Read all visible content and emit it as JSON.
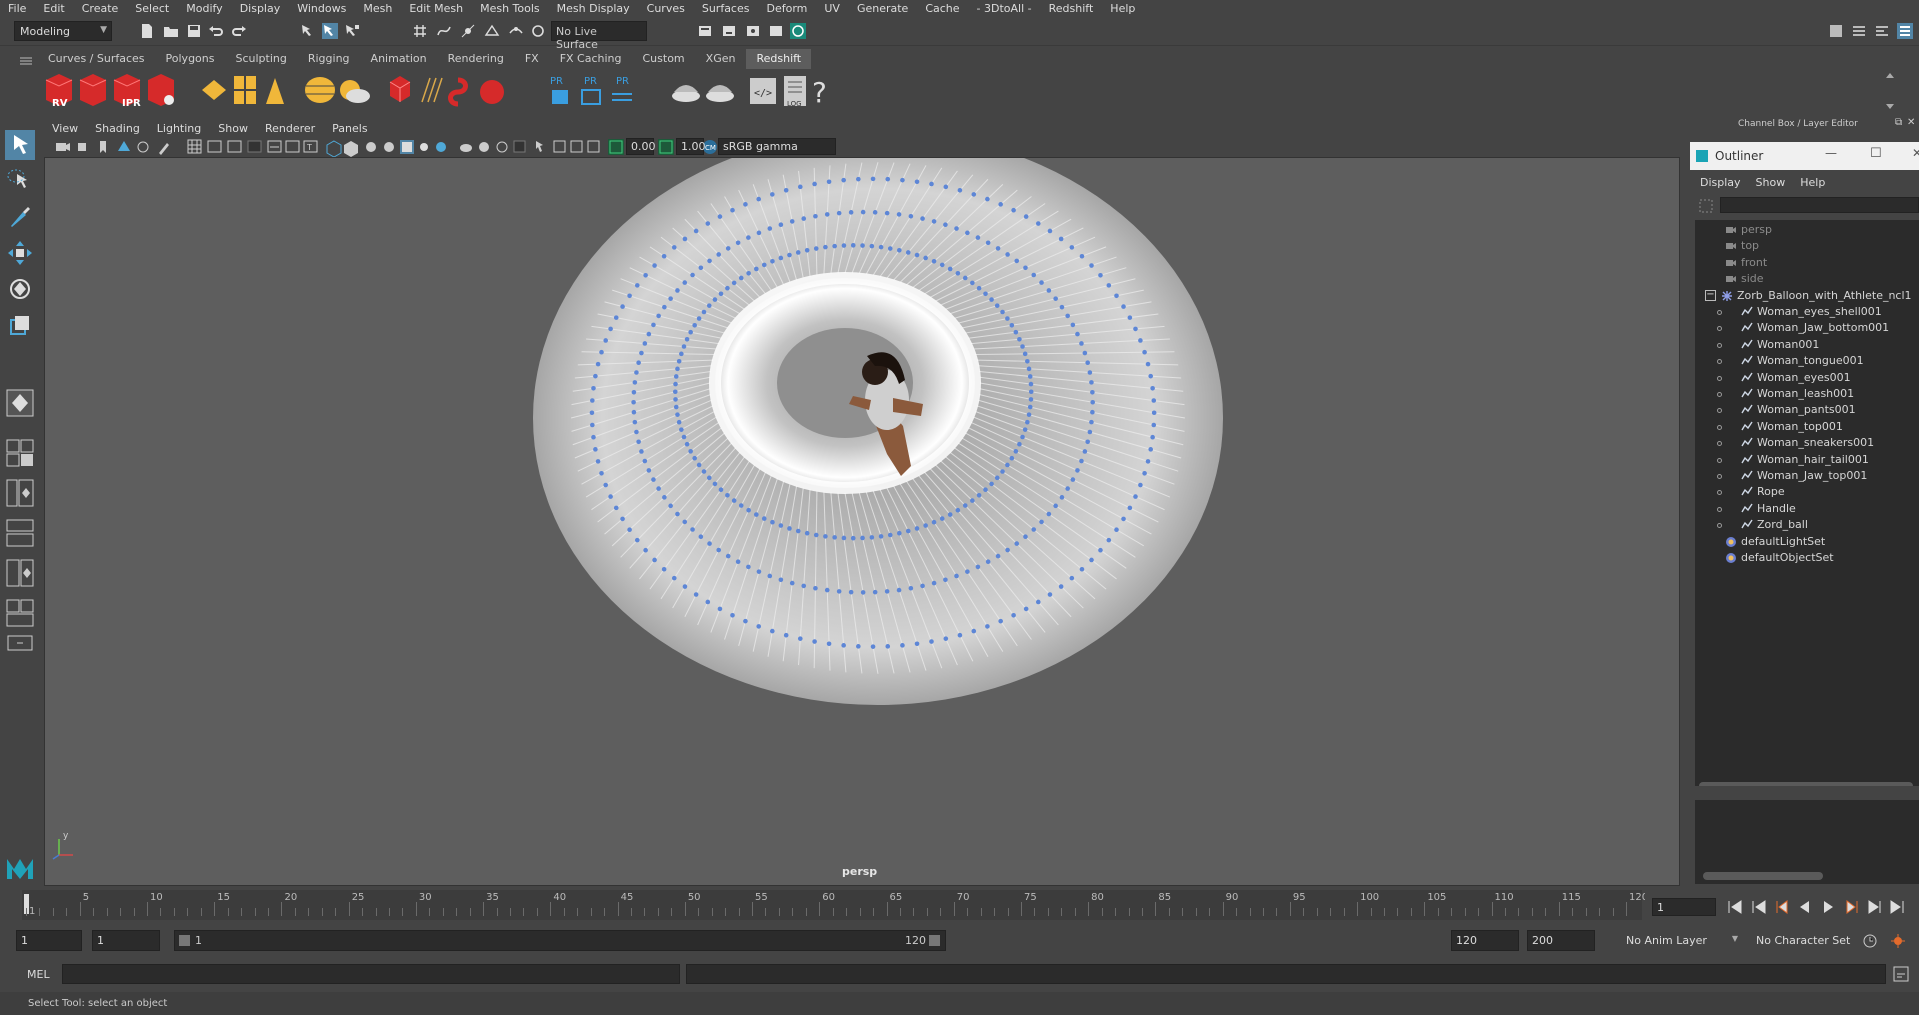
{
  "menus": [
    "File",
    "Edit",
    "Create",
    "Select",
    "Modify",
    "Display",
    "Windows",
    "Mesh",
    "Edit Mesh",
    "Mesh Tools",
    "Mesh Display",
    "Curves",
    "Surfaces",
    "Deform",
    "UV",
    "Generate",
    "Cache",
    "- 3DtoAll -",
    "Redshift",
    "Help"
  ],
  "status": {
    "mode": "Modeling",
    "live_surface": "No Live Surface"
  },
  "shelf": {
    "tabs": [
      "Curves / Surfaces",
      "Polygons",
      "Sculpting",
      "Rigging",
      "Animation",
      "Rendering",
      "FX",
      "FX Caching",
      "Custom",
      "XGen",
      "Redshift"
    ],
    "active_tab": "Redshift",
    "rv": "RV",
    "ipr": "IPR",
    "pr": "PR",
    "log": "LOG"
  },
  "panel": {
    "menus": [
      "View",
      "Shading",
      "Lighting",
      "Show",
      "Renderer",
      "Panels"
    ],
    "exposure": "0.00",
    "gamma": "1.00",
    "colorspace": "sRGB gamma",
    "camera": "persp",
    "axis_label": "y"
  },
  "right_panel": {
    "header": "Channel Box / Layer Editor",
    "outliner_title": "Outliner",
    "outliner_menus": [
      "Display",
      "Show",
      "Help"
    ],
    "items": [
      {
        "label": "persp",
        "type": "camera",
        "dim": true,
        "indent": 1
      },
      {
        "label": "top",
        "type": "camera",
        "dim": true,
        "indent": 1
      },
      {
        "label": "front",
        "type": "camera",
        "dim": true,
        "indent": 1
      },
      {
        "label": "side",
        "type": "camera",
        "dim": true,
        "indent": 1
      },
      {
        "label": "Zorb_Balloon_with_Athlete_ncl1",
        "type": "group",
        "dim": false,
        "indent": 0
      },
      {
        "label": "Woman_eyes_shell001",
        "type": "mesh",
        "dim": false,
        "indent": 2
      },
      {
        "label": "Woman_Jaw_bottom001",
        "type": "mesh",
        "dim": false,
        "indent": 2
      },
      {
        "label": "Woman001",
        "type": "mesh",
        "dim": false,
        "indent": 2
      },
      {
        "label": "Woman_tongue001",
        "type": "mesh",
        "dim": false,
        "indent": 2
      },
      {
        "label": "Woman_eyes001",
        "type": "mesh",
        "dim": false,
        "indent": 2
      },
      {
        "label": "Woman_leash001",
        "type": "mesh",
        "dim": false,
        "indent": 2
      },
      {
        "label": "Woman_pants001",
        "type": "mesh",
        "dim": false,
        "indent": 2
      },
      {
        "label": "Woman_top001",
        "type": "mesh",
        "dim": false,
        "indent": 2
      },
      {
        "label": "Woman_sneakers001",
        "type": "mesh",
        "dim": false,
        "indent": 2
      },
      {
        "label": "Woman_hair_tail001",
        "type": "mesh",
        "dim": false,
        "indent": 2
      },
      {
        "label": "Woman_Jaw_top001",
        "type": "mesh",
        "dim": false,
        "indent": 2
      },
      {
        "label": "Rope",
        "type": "mesh",
        "dim": false,
        "indent": 2
      },
      {
        "label": "Handle",
        "type": "mesh",
        "dim": false,
        "indent": 2
      },
      {
        "label": "Zord_ball",
        "type": "mesh",
        "dim": false,
        "indent": 2
      },
      {
        "label": "defaultLightSet",
        "type": "set",
        "dim": false,
        "indent": 1
      },
      {
        "label": "defaultObjectSet",
        "type": "set",
        "dim": false,
        "indent": 1
      }
    ]
  },
  "timeline": {
    "ticks": [
      "1",
      "5",
      "10",
      "15",
      "20",
      "25",
      "30",
      "35",
      "40",
      "45",
      "50",
      "55",
      "60",
      "65",
      "70",
      "75",
      "80",
      "85",
      "90",
      "95",
      "100",
      "105",
      "110",
      "115",
      "120"
    ],
    "current_frame": "1"
  },
  "range": {
    "start": "1",
    "playback_start": "1",
    "slider_start": "1",
    "slider_end": "120",
    "playback_end": "120",
    "end": "200",
    "anim_layer": "No Anim Layer",
    "character_set": "No Character Set"
  },
  "command": {
    "lang": "MEL"
  },
  "help_line": "Select Tool: select an object"
}
